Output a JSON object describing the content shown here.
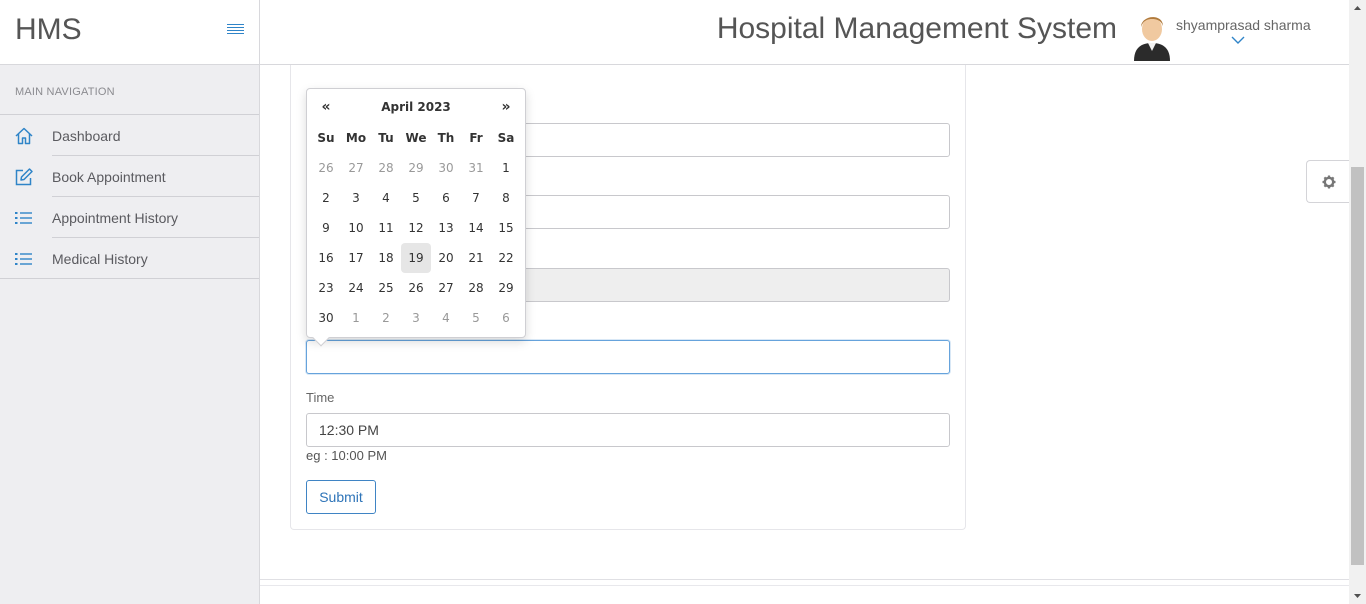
{
  "brand": "HMS",
  "header": {
    "title": "Hospital Management System",
    "username": "shyamprasad sharma"
  },
  "sidebar": {
    "heading": "MAIN NAVIGATION",
    "items": [
      {
        "label": "Dashboard",
        "icon": "home-icon"
      },
      {
        "label": "Book Appointment",
        "icon": "edit-icon"
      },
      {
        "label": "Appointment History",
        "icon": "list-icon"
      },
      {
        "label": "Medical History",
        "icon": "list-icon"
      }
    ]
  },
  "form": {
    "time_label": "Time",
    "time_value": "12:30 PM",
    "time_hint": "eg : 10:00 PM",
    "submit_label": "Submit"
  },
  "datepicker": {
    "prev": "«",
    "next": "»",
    "month": "April 2023",
    "weekdays": [
      "Su",
      "Mo",
      "Tu",
      "We",
      "Th",
      "Fr",
      "Sa"
    ],
    "weeks": [
      [
        "26",
        "27",
        "28",
        "29",
        "30",
        "31",
        "1"
      ],
      [
        "2",
        "3",
        "4",
        "5",
        "6",
        "7",
        "8"
      ],
      [
        "9",
        "10",
        "11",
        "12",
        "13",
        "14",
        "15"
      ],
      [
        "16",
        "17",
        "18",
        "19",
        "20",
        "21",
        "22"
      ],
      [
        "23",
        "24",
        "25",
        "26",
        "27",
        "28",
        "29"
      ],
      [
        "30",
        "1",
        "2",
        "3",
        "4",
        "5",
        "6"
      ]
    ],
    "today": "19"
  },
  "colors": {
    "accent": "#2f84c8",
    "sidebar_bg": "#eeeef1"
  }
}
